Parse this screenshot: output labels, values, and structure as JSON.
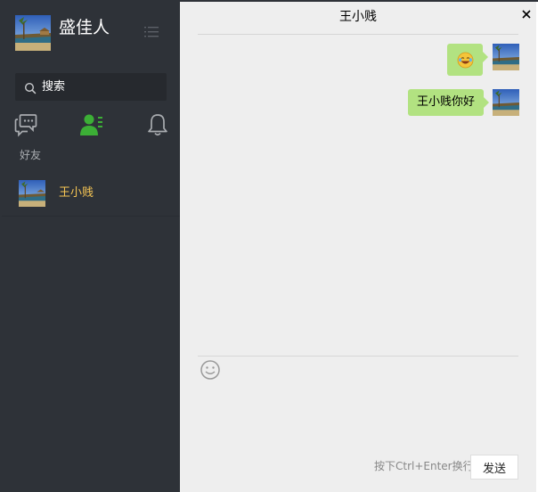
{
  "user": {
    "name": "盛佳人",
    "avatar_icon": "landscape-avatar"
  },
  "search": {
    "placeholder": "搜索",
    "value": ""
  },
  "tabs": [
    {
      "name": "chats",
      "icon": "chat-bubbles-icon",
      "active": false
    },
    {
      "name": "contacts",
      "icon": "contacts-icon",
      "active": true
    },
    {
      "name": "notifications",
      "icon": "bell-icon",
      "active": false
    }
  ],
  "contacts": {
    "section_label": "好友",
    "items": [
      {
        "name": "王小贱",
        "selected": true
      }
    ]
  },
  "chat": {
    "title": "王小贱",
    "messages": [
      {
        "type": "emoji",
        "emoji": "laughing-face"
      },
      {
        "type": "text",
        "text": "王小贱你好"
      }
    ],
    "input_value": "",
    "send_hint": "按下Ctrl+Enter换行",
    "send_label": "发送"
  },
  "colors": {
    "sidebar_bg": "#2e3238",
    "search_bg": "#26292e",
    "chat_bg": "#eeeeee",
    "bubble": "#b2e281",
    "accent_green": "#3caf36",
    "selected_name": "#f7c654"
  }
}
